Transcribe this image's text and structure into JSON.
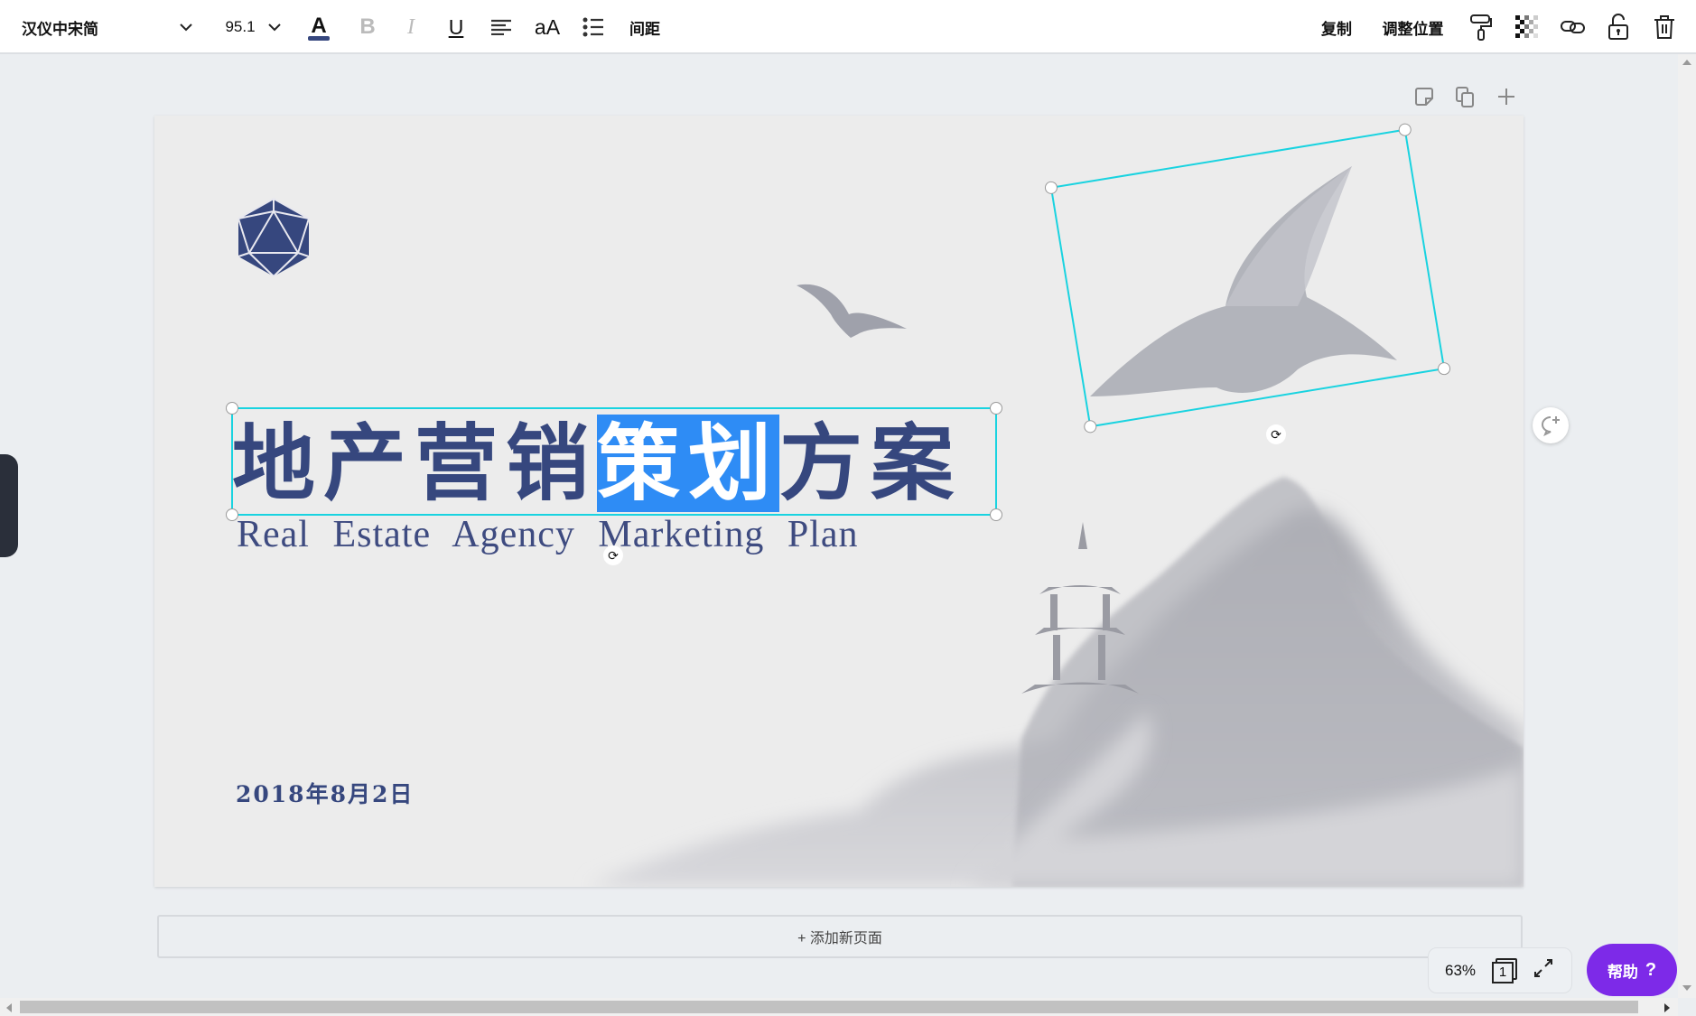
{
  "toolbar": {
    "font_family": "汉仪中宋简",
    "font_size": "95.1",
    "spacing_label": "间距",
    "case_label": "aA",
    "copy_label": "复制",
    "position_label": "调整位置",
    "text_color": "#36477e",
    "icons": [
      "chevron-down-icon",
      "text-color-icon",
      "bold-icon",
      "italic-icon",
      "underline-icon",
      "align-left-icon",
      "case-icon",
      "list-icon",
      "paint-roller-icon",
      "transparency-icon",
      "link-icon",
      "unlock-icon",
      "trash-icon"
    ]
  },
  "slide": {
    "title_before": "地产营销",
    "title_selected": "策划",
    "title_after": "方案",
    "subtitle": "Real Estate Agency Marketing Plan",
    "date": "2018年8月2日",
    "selection_color": "#19d3e0",
    "highlight_color": "#2e8cf5"
  },
  "add_page_label": "+ 添加新页面",
  "footer": {
    "zoom": "63%",
    "page_number": "1",
    "help_label": "帮助",
    "help_icon": "?",
    "help_color": "#7d2ae8"
  }
}
